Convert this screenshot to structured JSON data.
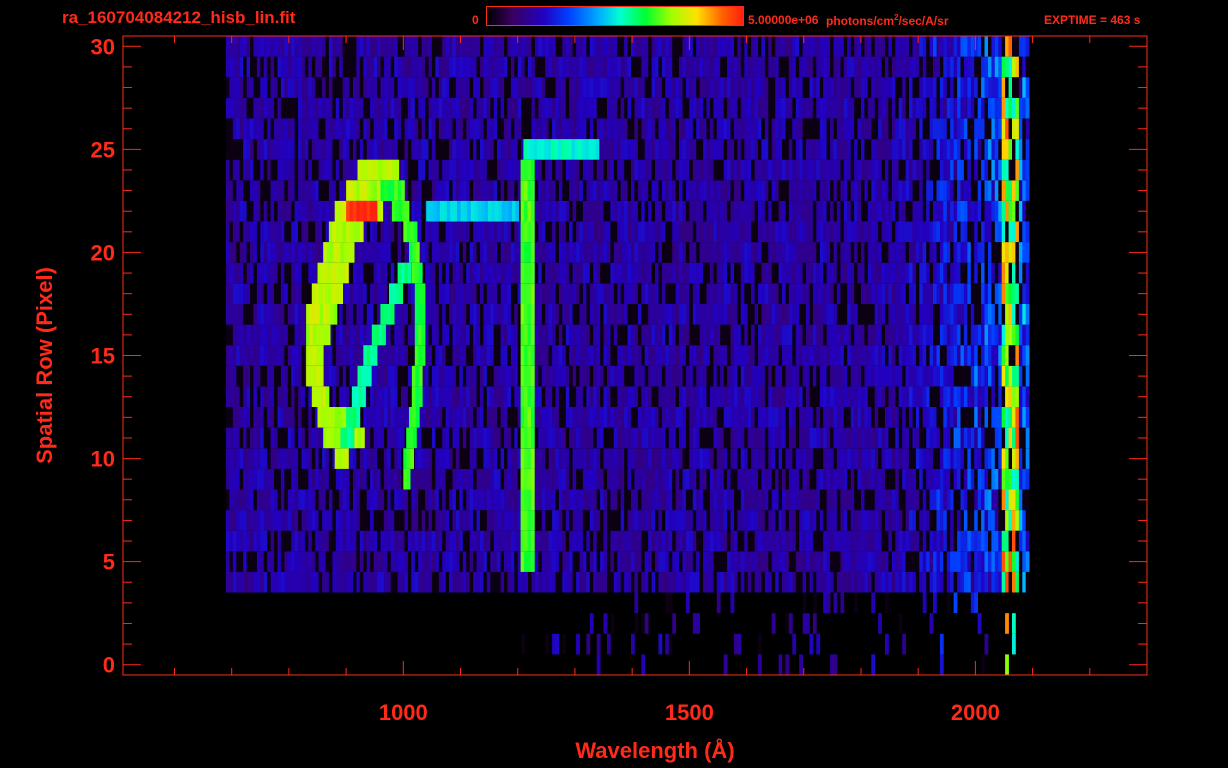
{
  "header": {
    "filename": "ra_160704084212_hisb_lin.fit",
    "colorbar_min_label": "0",
    "colorbar_max_label": "5.00000e+06",
    "colorbar_unit_label": "photons/cm",
    "colorbar_unit_sup": "2",
    "colorbar_unit_tail": "/sec/A/sr",
    "exptime_label": "EXPTIME = 463 s"
  },
  "colors": {
    "axis": "#ff2a1a",
    "background": "#000000"
  },
  "chart_data": {
    "type": "heatmap",
    "title": "ra_160704084212_hisb_lin.fit",
    "xlabel": "Wavelength (Å)",
    "ylabel": "Spatial Row (Pixel)",
    "xlim": [
      510,
      2300
    ],
    "ylim": [
      -0.5,
      30.5
    ],
    "x_ticks": [
      1000,
      1500,
      2000
    ],
    "x_tick_labels": [
      "1000",
      "1500",
      "2000"
    ],
    "y_ticks": [
      0,
      5,
      10,
      15,
      20,
      25,
      30
    ],
    "y_tick_labels": [
      "0",
      "5",
      "10",
      "15",
      "20",
      "25",
      "30"
    ],
    "colorbar": {
      "min": 0,
      "max": 5000000,
      "unit": "photons/cm^2/sec/A/sr",
      "colormap": "rainbow"
    },
    "features": [
      {
        "name": "Ly-alpha line",
        "x": 1216,
        "y_range": [
          5,
          24
        ]
      },
      {
        "name": "long-wavelength edge",
        "x": 2060,
        "y_range": [
          0,
          30
        ]
      }
    ]
  }
}
